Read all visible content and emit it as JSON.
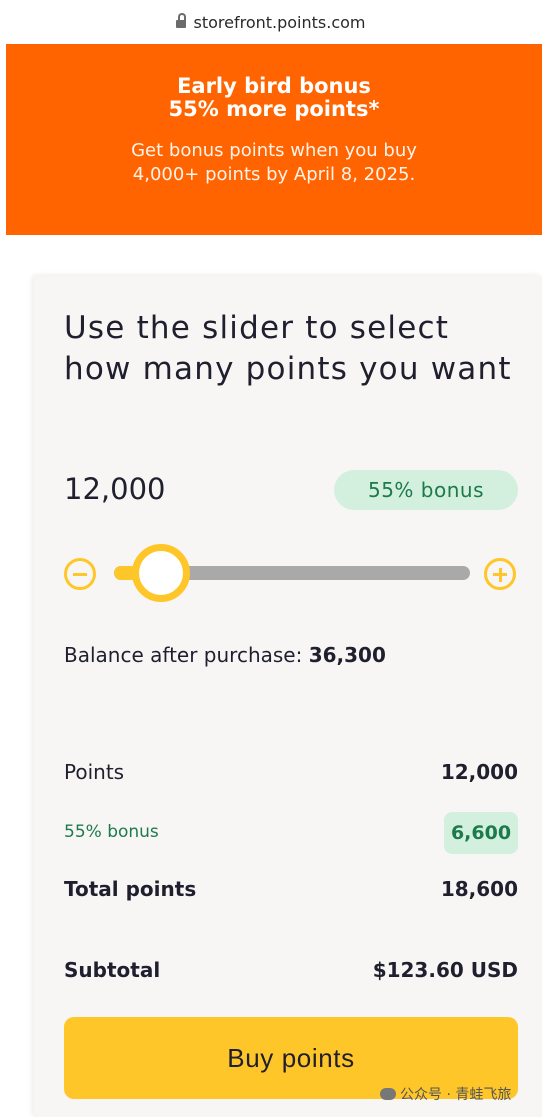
{
  "browser": {
    "url": "storefront.points.com"
  },
  "banner": {
    "title_line1": "Early bird bonus",
    "title_line2": "55% more points*",
    "sub_line1": "Get bonus points when you buy",
    "sub_line2": "4,000+ points by April 8, 2025."
  },
  "card": {
    "title": "Use the slider to select how many points you want",
    "amount": "12,000",
    "bonus_badge": "55% bonus",
    "slider": {
      "min_label": "minus",
      "max_label": "plus",
      "level_fraction": 0.07
    },
    "balance_label": "Balance after purchase:",
    "balance_value": "36,300",
    "summary": {
      "points_label": "Points",
      "points_value": "12,000",
      "bonus_label": "55% bonus",
      "bonus_value": "6,600",
      "total_label": "Total points",
      "total_value": "18,600",
      "subtotal_label": "Subtotal",
      "subtotal_value": "$123.60 USD"
    },
    "buy_button": "Buy points"
  },
  "watermark": {
    "text": "公众号 · 青蛙飞旅"
  },
  "colors": {
    "banner": "#ff6400",
    "accent": "#ffc629",
    "bonus_bg": "#d3f0de",
    "bonus_text": "#1d7a4b"
  }
}
